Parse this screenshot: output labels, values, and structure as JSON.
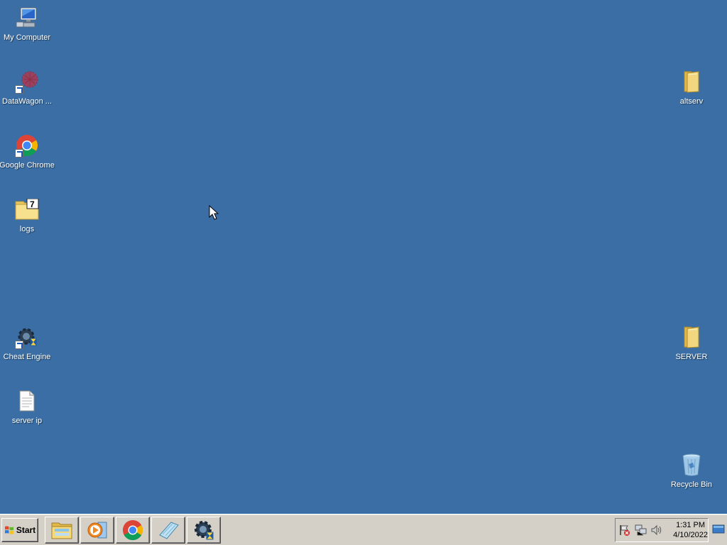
{
  "desktop": {
    "background_color": "#3a6ea5",
    "icons": [
      {
        "label": "My Computer",
        "icon": "computer-icon"
      },
      {
        "label": "DataWagon ...",
        "icon": "datawagon-icon",
        "shortcut": true
      },
      {
        "label": "Google Chrome",
        "icon": "chrome-icon",
        "shortcut": true
      },
      {
        "label": "logs",
        "icon": "7zip-folder-icon"
      },
      {
        "label": "Cheat Engine",
        "icon": "cheat-engine-icon",
        "shortcut": true
      },
      {
        "label": "server ip",
        "icon": "text-file-icon"
      },
      {
        "label": "altserv",
        "icon": "folder-icon"
      },
      {
        "label": "SERVER",
        "icon": "folder-icon"
      },
      {
        "label": "Recycle Bin",
        "icon": "recycle-bin-icon"
      }
    ]
  },
  "taskbar": {
    "start_label": "Start",
    "pinned": [
      {
        "name": "Windows Explorer",
        "icon": "explorer-icon"
      },
      {
        "name": "Media Player",
        "icon": "media-player-icon"
      },
      {
        "name": "Google Chrome",
        "icon": "chrome-icon"
      },
      {
        "name": "Notepad",
        "icon": "notepad-icon"
      },
      {
        "name": "Cheat Engine",
        "icon": "cheat-engine-icon"
      }
    ],
    "tray": {
      "icons": [
        "action-center-flag-icon",
        "network-icon",
        "volume-icon"
      ],
      "time": "1:31 PM",
      "date": "4/10/2022"
    }
  }
}
